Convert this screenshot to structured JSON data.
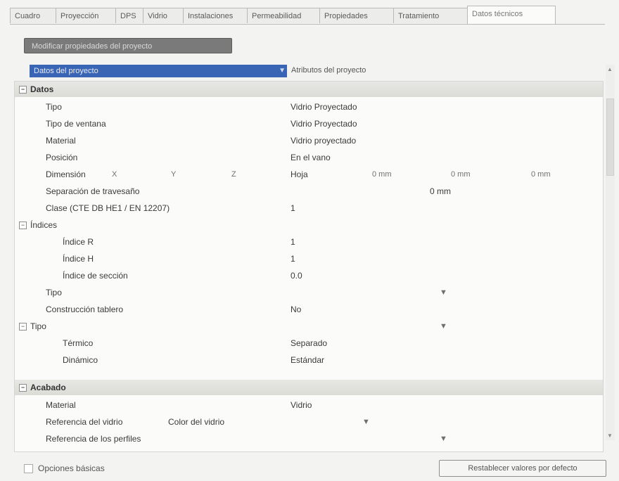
{
  "tabs": [
    "Cuadro",
    "Proyección",
    "DPS",
    "Vidrio",
    "Instalaciones",
    "Permeabilidad",
    "Propiedades",
    "Tratamiento",
    "Datos técnicos"
  ],
  "header_button": "Modificar propiedades del proyecto",
  "selector": {
    "value": "Datos del proyecto",
    "description": "Atributos del proyecto"
  },
  "sections": [
    {
      "title": "Datos",
      "rows": [
        {
          "label": "Tipo",
          "value": "Vidrio Proyectado"
        },
        {
          "label": "Tipo de ventana",
          "value": "Vidrio Proyectado"
        },
        {
          "label": "Material",
          "value": "Vidrio proyectado"
        },
        {
          "label": "Posición",
          "value": "En el vano"
        },
        {
          "label": "Dimensión",
          "value": "Hoja",
          "extra": [
            "X",
            "Y",
            "Z",
            "0 mm",
            "0 mm",
            "0 mm"
          ]
        },
        {
          "label": "Separación de travesaño",
          "value": "0 mm"
        },
        {
          "label": "Clase (CTE DB HE1 / EN 12207)",
          "value": "1"
        },
        {
          "label": "Índices",
          "value": ""
        },
        {
          "label": "Índice R",
          "value": "1"
        },
        {
          "label": "Índice H",
          "value": "1"
        },
        {
          "label": "Índice de sección",
          "value": "0.0"
        },
        {
          "label": "Tipo",
          "value": ""
        },
        {
          "label": "Construcción tablero",
          "value": "No"
        },
        {
          "label": "Tipo",
          "value": ""
        },
        {
          "label": "Térmico",
          "value": "Separado"
        },
        {
          "label": "Dinámico",
          "value": "Estándar"
        }
      ]
    },
    {
      "title": "Acabado",
      "rows": [
        {
          "label": "Material",
          "value": "Vidrio"
        },
        {
          "label": "Referencia del vidrio",
          "value": "Color del vidrio"
        },
        {
          "label": "Referencia de los perfiles",
          "value": ""
        }
      ]
    }
  ],
  "footer": {
    "checkbox_label": "Opciones básicas",
    "reset_button": "Restablecer valores por defecto"
  },
  "icons": {
    "expand": "minus-box-icon",
    "dropdown": "chevron-down-icon"
  },
  "colors": {
    "selector_bg": "#3a64b4",
    "header_button_bg": "#7a7a7a",
    "section_bg": "#e2e2de"
  }
}
